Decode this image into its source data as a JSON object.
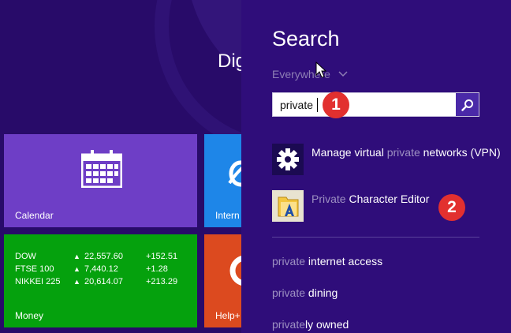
{
  "start": {
    "title": "Dig",
    "tiles": {
      "calendar": "Calendar",
      "ie": "Intern",
      "money": "Money",
      "help": "Help+"
    },
    "stocks": [
      {
        "name": "DOW",
        "value": "22,557.60",
        "change": "+152.51"
      },
      {
        "name": "FTSE 100",
        "value": "7,440.12",
        "change": "+1.28"
      },
      {
        "name": "NIKKEI 225",
        "value": "20,614.07",
        "change": "+213.29"
      }
    ]
  },
  "search": {
    "title": "Search",
    "scope": "Everywhere",
    "query": "private",
    "badges": [
      "1",
      "2"
    ],
    "results": [
      {
        "pre": "Manage virtual ",
        "hl": "private",
        "post": " networks (VPN)",
        "icon": "gear-icon"
      },
      {
        "pre": "",
        "hl": "Private",
        "post": " Character Editor",
        "icon": "character-editor-icon"
      }
    ],
    "suggestions": [
      {
        "q": "private",
        "rest": " internet access"
      },
      {
        "q": "private",
        "rest": " dining"
      },
      {
        "q": "private",
        "rest": "ly owned"
      }
    ]
  },
  "colors": {
    "charm_bg": "#2f0d7a",
    "start_bg": "#280b69",
    "calendar_tile": "#6e3ec6",
    "money_tile": "#05a10d",
    "ie_tile": "#1e86e8",
    "help_tile": "#dc4a1f",
    "badge": "#e2302f",
    "search_button": "#4a29a8"
  }
}
